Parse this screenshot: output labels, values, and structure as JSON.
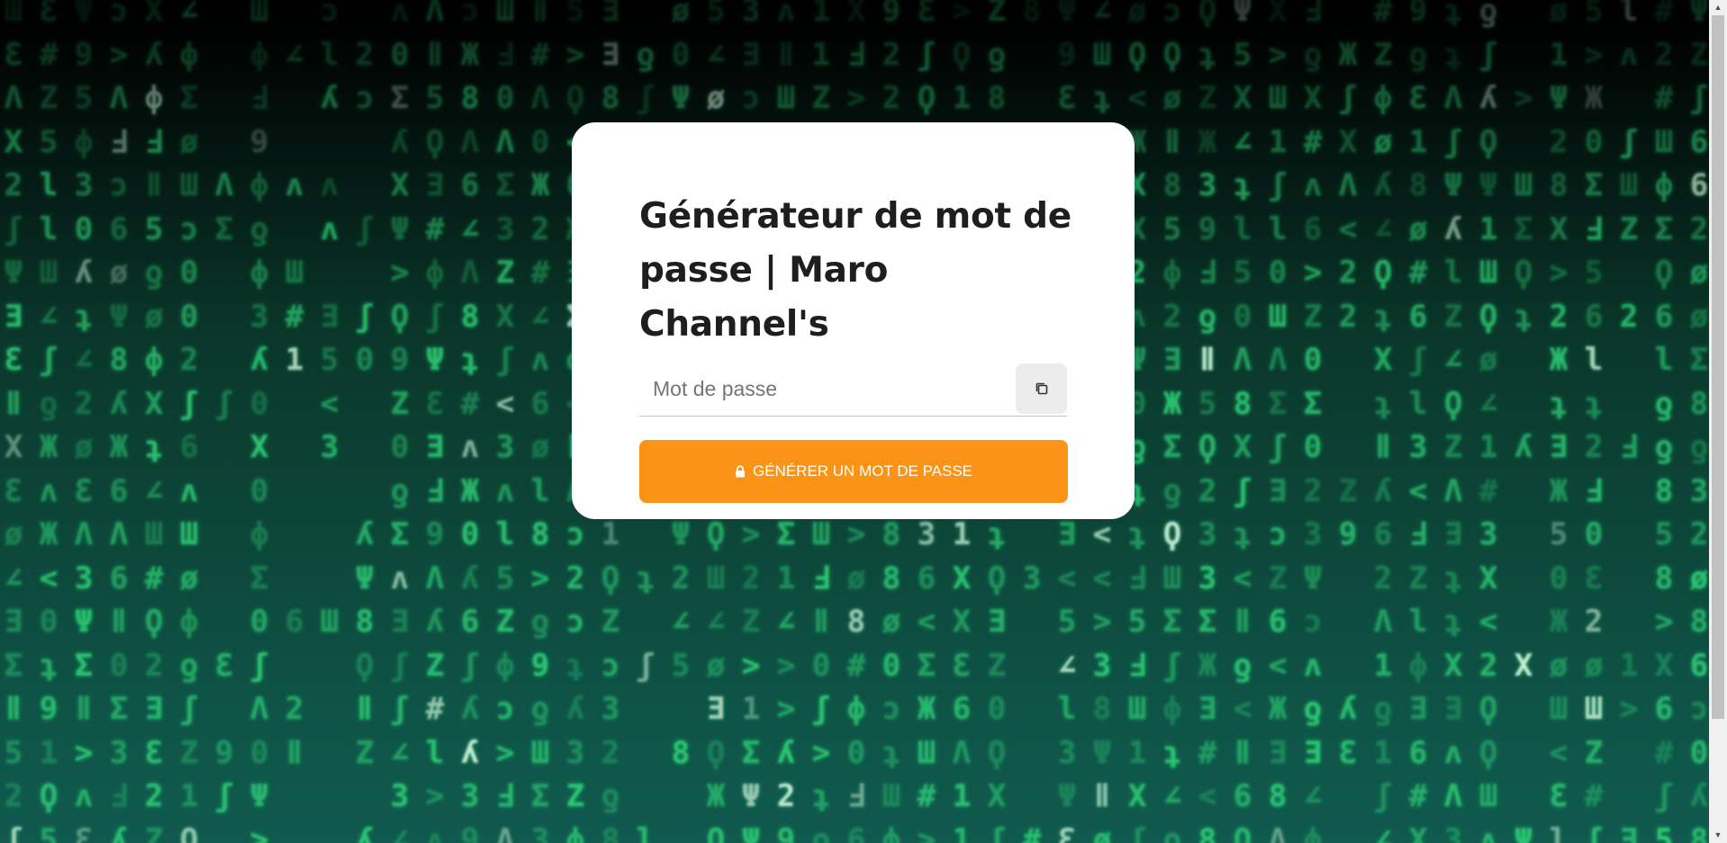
{
  "card": {
    "title": "Générateur de mot de passe | Maro Channel's"
  },
  "password": {
    "placeholder": "Mot de passe",
    "value": ""
  },
  "copy_button": {
    "icon": "copy-icon"
  },
  "generate_button": {
    "icon": "lock-icon",
    "label": "GÉNÉRER UN MOT DE PASSE"
  },
  "colors": {
    "accent": "#fb9416",
    "card_background": "#ffffff",
    "title_text": "#1e1e1e",
    "background_dark": "#000000",
    "background_teal": "#115e52",
    "rain_glyphs": "#2fd37a"
  },
  "background": {
    "type": "matrix-code-rain"
  }
}
